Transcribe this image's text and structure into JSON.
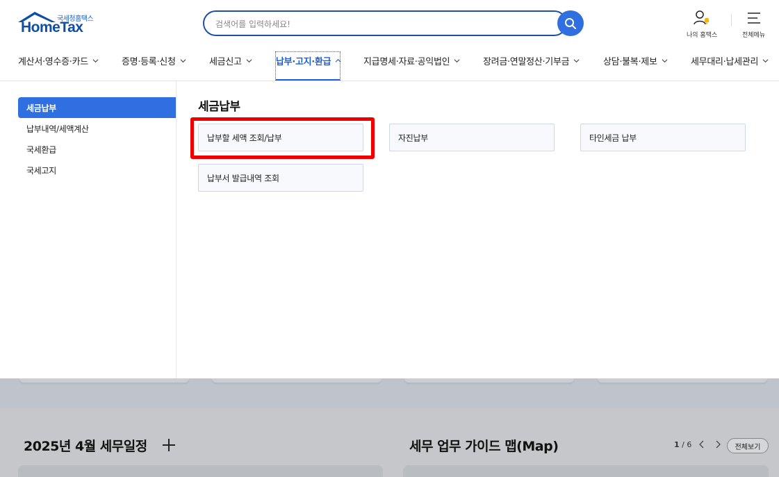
{
  "header": {
    "logo_sub": "국세청홈택스",
    "logo_main": "HomeTax",
    "search_placeholder": "검색어를 입력하세요!",
    "my_hometax_label": "나의 홈택스",
    "all_menu_label": "전체메뉴"
  },
  "gnb": {
    "items": [
      {
        "label": "계산서·영수증·카드"
      },
      {
        "label": "증명·등록·신청"
      },
      {
        "label": "세금신고"
      },
      {
        "label": "납부·고지·환급"
      },
      {
        "label": "지급명세·자료·공익법인"
      },
      {
        "label": "장려금·연말정산·기부금"
      },
      {
        "label": "상담·불복·제보"
      },
      {
        "label": "세무대리·납세관리"
      }
    ],
    "active_index": 3
  },
  "sidebar": {
    "items": [
      {
        "label": "세금납부"
      },
      {
        "label": "납부내역/세액계산"
      },
      {
        "label": "국세환급"
      },
      {
        "label": "국세고지"
      }
    ]
  },
  "panel": {
    "title": "세금납부",
    "links": [
      {
        "label": "납부할 세액 조회/납부"
      },
      {
        "label": "자진납부"
      },
      {
        "label": "타인세금 납부"
      },
      {
        "label": "납부서 발급내역 조회"
      }
    ]
  },
  "background": {
    "schedule_title": "2025년 4월 세무일정",
    "guide_title": "세무 업무 가이드 맵(Map)",
    "page_current": "1",
    "page_total": "/ 6",
    "view_all_label": "전체보기"
  },
  "colors": {
    "accent": "#2f6fe0",
    "highlight": "#ee0000"
  }
}
